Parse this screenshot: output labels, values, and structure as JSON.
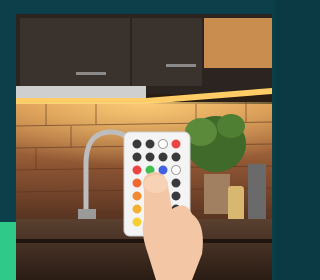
{
  "image": {
    "subject": "hand-holding-rgb-led-remote-in-kitchen",
    "colors": {
      "frame": "#0d3f4a",
      "accent": "#2fc98a",
      "led_glow": "#ffb347",
      "wall_brick": "#7a4a2e"
    }
  }
}
